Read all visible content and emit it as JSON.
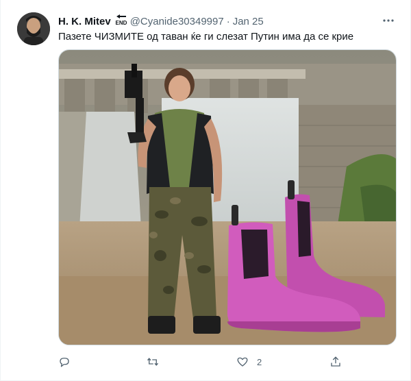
{
  "tweet": {
    "display_name": "H. K. Mitev",
    "name_emoji": "end-arrow-icon",
    "handle": "@Cyanide30349997",
    "separator": "·",
    "date": "Jan 25",
    "text": "Пазете ЧИЗМИТЕ од таван ќе ги слезат Путин има да се крие"
  },
  "media": {
    "subject": "person-in-camouflage-icon",
    "overlay": "pink-rain-boots-icon"
  },
  "actions": {
    "reply_count": "",
    "retweet_count": "",
    "like_count": "2",
    "share_count": ""
  },
  "colors": {
    "text": "#0f1419",
    "secondary": "#536471",
    "border": "#cfd9de",
    "boot_pink": "#c95fb7"
  }
}
